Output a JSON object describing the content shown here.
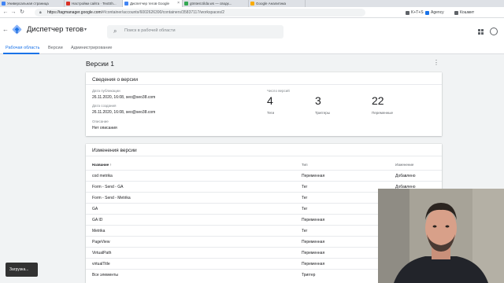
{
  "browser": {
    "tabs": [
      {
        "label": "Универсальная страница",
        "color": "#4285f4"
      },
      {
        "label": "Настройки сайта · TextSh...",
        "color": "#d93025"
      },
      {
        "label": "Диспетчер тегов Google",
        "color": "#4285f4"
      },
      {
        "label": "gtmtest.tilda.ws — сводк...",
        "color": "#34a853"
      },
      {
        "label": "Google Аналитика",
        "color": "#f9ab00"
      }
    ],
    "url_host": "https://tagmanager.google.com",
    "url_path": "/#/container/accounts/6002626390/containers/35837117/workspaces/2",
    "bookmarks": [
      "K+T+S",
      "Agency",
      "Кошмит"
    ]
  },
  "app": {
    "title": "Диспетчер тегов",
    "search_placeholder": "Поиск в рабочей области"
  },
  "nav": {
    "tabs": [
      "Рабочая область",
      "Версии",
      "Администрирование"
    ]
  },
  "page": {
    "title": "Версии 1"
  },
  "info_card": {
    "title": "Сведения о версии",
    "published_label": "Дата публикации",
    "published_value": "26.11.2020, 16:08, seo@seo38.com",
    "created_label": "Дата создания",
    "created_value": "26.11.2020, 16:08, seo@seo38.com",
    "desc_label": "Описание",
    "desc_value": "Нет описания",
    "count_label": "Число версий",
    "stats": [
      {
        "num": "4",
        "label": "Теги"
      },
      {
        "num": "3",
        "label": "Триггеры"
      },
      {
        "num": "22",
        "label": "Переменные"
      }
    ]
  },
  "changes": {
    "title": "Изменения версии",
    "col_name": "Название",
    "sort_arrow": "↑",
    "col_type": "Тип",
    "col_change": "Изменение",
    "rows": [
      {
        "name": "cod metrika",
        "type": "Переменная",
        "change": "Добавлено"
      },
      {
        "name": "Form - Send - GA",
        "type": "Тег",
        "change": "Добавлено"
      },
      {
        "name": "Form - Send - Metrika",
        "type": "Тег",
        "change": ""
      },
      {
        "name": "GA",
        "type": "Тег",
        "change": ""
      },
      {
        "name": "GA ID",
        "type": "Переменная",
        "change": ""
      },
      {
        "name": "Metrika",
        "type": "Тег",
        "change": ""
      },
      {
        "name": "PageView",
        "type": "Переменная",
        "change": ""
      },
      {
        "name": "VirtualPath",
        "type": "Переменная",
        "change": ""
      },
      {
        "name": "virtualTitle",
        "type": "Переменная",
        "change": ""
      },
      {
        "name": "Все элементы",
        "type": "Триггер",
        "change": ""
      }
    ]
  },
  "toast": {
    "text": "Загрузка..."
  },
  "colors": {
    "accent": "#1a73e8"
  }
}
